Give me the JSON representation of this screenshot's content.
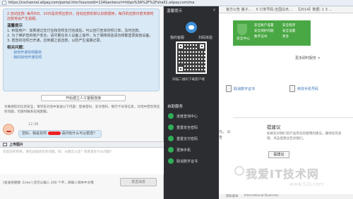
{
  "url": "https://cschannel.alipay.com/portal.htm?sourceId=114&enterurl=https%3A%2F%2Fshall1.alipay.com/ma",
  "tabs": [
    "官方公告 童子...",
    "X 订单号码:全国白天...",
    "【2014】数据: 1 3 ..."
  ],
  "chat": {
    "intro_red": "2 自动还款: 每月8日、10日是花呗还款日，自动还款的默认扣款顺序，每月的还款日若未按时还款将会产生逾期。",
    "faq_title": "温馨提示",
    "faq_lines": [
      "1. 积极用户：如果通过支付宝和花呗支付完成后，可以自行查询花呗订单，及时还款。",
      "2. 为了维护您的账户安全，请尽量在本人设备上操作，为了保障体验请勿频繁登录其他设备。",
      "3. 若您的花呗已开通，应到期之前还款，以防产生逾期记录。"
    ],
    "related_title": "相关问题：",
    "related_links": [
      "· 如何开通花呗服务",
      "· 我的如何开通花呗"
    ],
    "transfer_button": "开始建立人工客服连接",
    "notice": "为确保您的信息安全，请勿在对话中发送以下内容：登录密码、支付密码、银行卡号等信息，对话中若您有任何问题，可随时联系在线客服。",
    "timestamp": "12:36",
    "bubble_text": "您好，我是花呗",
    "bubble_suffix": "请问有什么可以帮您？",
    "upload_label": "上传图片",
    "input_placeholder": "欢迎您的到来，请在此描述您的问题，如：分期怎么还？或者发生什么问题？",
    "footer_hint": "[发送快捷键: Enter] 还可以输入 200 个字，请输入简体中文哦",
    "send_button": "发送消息"
  },
  "overlay": {
    "title": "温馨提示",
    "close": "×",
    "tab_customer": "我的客服",
    "tab_scan": "扫码体验",
    "qr_caption": "扫描二维码下载客户端",
    "section_title": "自助服务",
    "items": [
      "进度查询中心",
      "重置安全密码",
      "重置支付密码",
      "更换手机",
      "取消数字证书"
    ]
  },
  "bg_page": {
    "security_label": "安全中心",
    "green_links": [
      "安全账户设置",
      "安全程序",
      "安全保护问题",
      "安全设置",
      "数字证书",
      "更多"
    ],
    "more_link": "更多即时服务 >",
    "actions": [
      "取消数字证书",
      "修改手机号码"
    ],
    "feedback_title": "提建议",
    "feedback_text": "如果您对我们的产品有任何使用的建议，期待您的反馈，点击提建议告诉我们。",
    "feedback_button": "提建议",
    "side_text": "元，\n公告",
    "footer_links": [
      "隐私版本",
      "International Business"
    ]
  },
  "watermark": {
    "main": "我爱IT技术网",
    "sub": "www.52ij.com"
  },
  "colors": {
    "overlay_bg": "#2b2d31",
    "green_card": "#4aa844",
    "chat_bubble": "#d9e9f6",
    "warning_red": "#d43a2a"
  }
}
